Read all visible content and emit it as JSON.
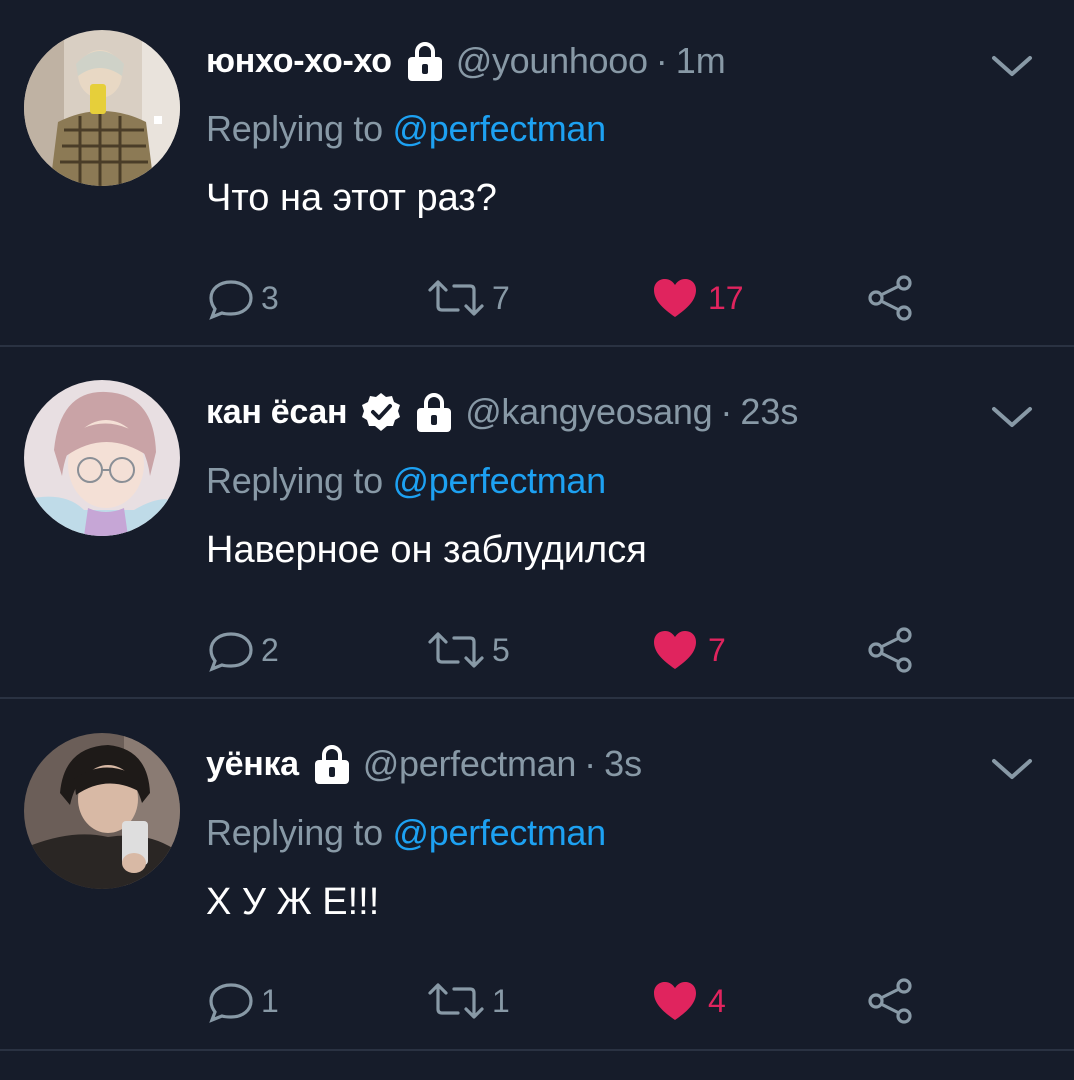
{
  "colors": {
    "background": "#161c2a",
    "divider": "#2a3242",
    "muted": "#8899a6",
    "link": "#1da1f2",
    "like": "#e0245e",
    "text": "#ffffff"
  },
  "tweets": [
    {
      "display_name": "юнхо-хо-хо",
      "protected": true,
      "verified": false,
      "handle": "@younhooo",
      "separator": "·",
      "time": "1m",
      "reply_prefix": "Replying to",
      "reply_to": "@perfectman",
      "text": "Что на этот раз?",
      "replies": "3",
      "retweets": "7",
      "likes": "17",
      "liked": true
    },
    {
      "display_name": "кан ёсан",
      "protected": true,
      "verified": true,
      "handle": "@kangyeosang",
      "separator": "·",
      "time": "23s",
      "reply_prefix": "Replying to",
      "reply_to": "@perfectman",
      "text": "Наверное он заблудился",
      "replies": "2",
      "retweets": "5",
      "likes": "7",
      "liked": true
    },
    {
      "display_name": "уёнка",
      "protected": true,
      "verified": false,
      "handle": "@perfectman",
      "separator": "·",
      "time": "3s",
      "reply_prefix": "Replying to",
      "reply_to": "@perfectman",
      "text": "Х У Ж Е!!!",
      "replies": "1",
      "retweets": "1",
      "likes": "4",
      "liked": true
    }
  ],
  "icons": {
    "lock": "lock-icon",
    "verified": "verified-badge-icon",
    "more": "chevron-down-icon",
    "reply": "reply-bubble-icon",
    "retweet": "retweet-icon",
    "like": "heart-icon",
    "share": "share-icon"
  }
}
